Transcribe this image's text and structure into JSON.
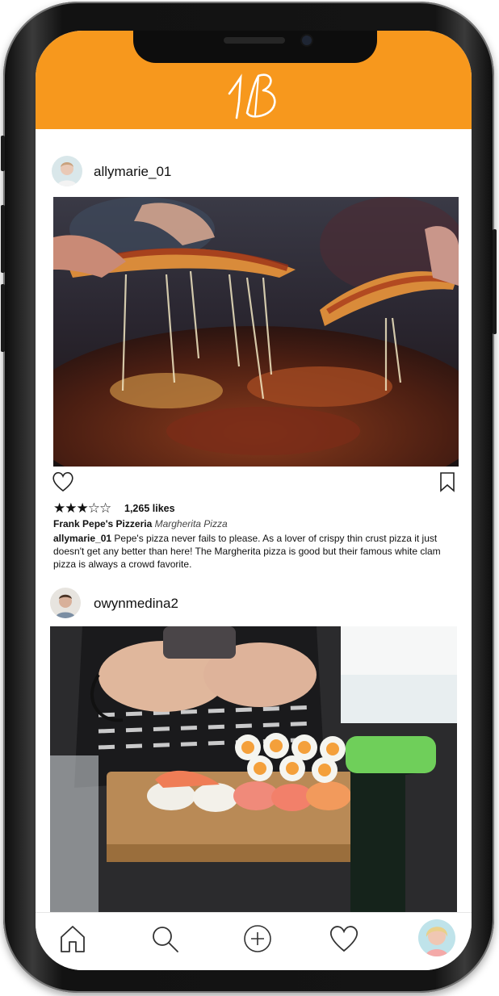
{
  "colors": {
    "header": "#f7981d",
    "frame": "#111111"
  },
  "header": {
    "logo_text": "1B",
    "logo_icon": "script-1B-logo"
  },
  "posts": [
    {
      "username": "allymarie_01",
      "photo_desc": "pizza",
      "rating": "★★★☆☆",
      "rating_value": 3,
      "rating_max": 5,
      "likes": "1,265 likes",
      "place": "Frank Pepe's Pizzeria",
      "dish": "Margherita Pizza",
      "caption_user": "allymarie_01",
      "caption_text": "Pepe's pizza never fails to please. As a lover of crispy thin crust pizza it just doesn't get any better than here! The Margherita pizza is good but their famous white clam pizza is always a crowd favorite.",
      "icons": [
        "heart-icon",
        "bookmark-icon"
      ]
    },
    {
      "username": "owynmedina2",
      "photo_desc": "sushi"
    }
  ],
  "tabbar": {
    "items": [
      {
        "name": "home",
        "icon": "home-icon"
      },
      {
        "name": "search",
        "icon": "search-icon"
      },
      {
        "name": "add",
        "icon": "plus-circle-icon"
      },
      {
        "name": "activity",
        "icon": "heart-icon"
      },
      {
        "name": "profile",
        "icon": "avatar"
      }
    ]
  }
}
